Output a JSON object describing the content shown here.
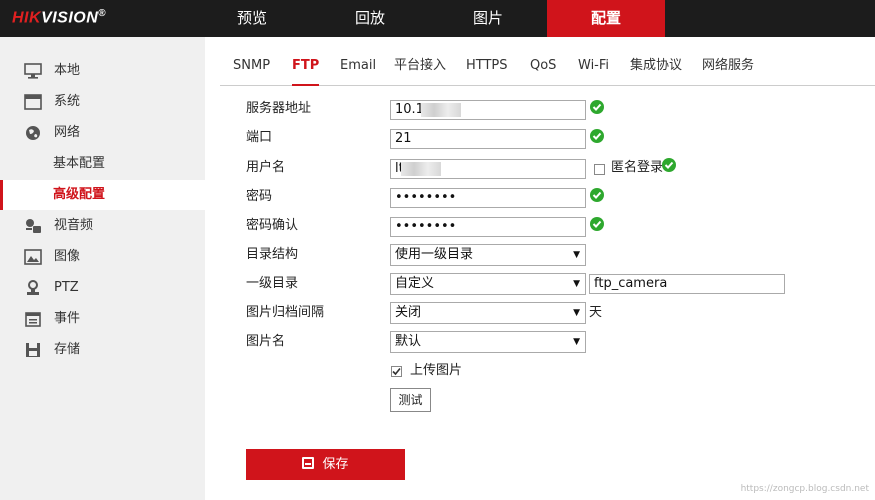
{
  "brand": {
    "hik": "HIK",
    "vision": "VISION",
    "reg": "®"
  },
  "topnav": [
    {
      "label": "预览",
      "active": false
    },
    {
      "label": "回放",
      "active": false
    },
    {
      "label": "图片",
      "active": false
    },
    {
      "label": "配置",
      "active": true
    }
  ],
  "sidebar": {
    "items": [
      {
        "label": "本地",
        "icon": "monitor-icon"
      },
      {
        "label": "系统",
        "icon": "window-icon"
      },
      {
        "label": "网络",
        "icon": "globe-icon"
      },
      {
        "label": "基本配置",
        "sub": true
      },
      {
        "label": "高级配置",
        "sub": true,
        "active": true
      },
      {
        "label": "视音频",
        "icon": "mic-camera-icon"
      },
      {
        "label": "图像",
        "icon": "image-icon"
      },
      {
        "label": "PTZ",
        "icon": "ptz-icon"
      },
      {
        "label": "事件",
        "icon": "calendar-icon"
      },
      {
        "label": "存储",
        "icon": "floppy-icon"
      }
    ]
  },
  "tabs": [
    "SNMP",
    "FTP",
    "Email",
    "平台接入",
    "HTTPS",
    "QoS",
    "Wi-Fi",
    "集成协议",
    "网络服务"
  ],
  "active_tab": "FTP",
  "form": {
    "server_label": "服务器地址",
    "server_value": "10.1.",
    "port_label": "端口",
    "port_value": "21",
    "user_label": "用户名",
    "user_value": "lt",
    "anon_label": "匿名登录",
    "password_label": "密码",
    "password_value": "••••••••",
    "confirm_label": "密码确认",
    "confirm_value": "••••••••",
    "dir_structure_label": "目录结构",
    "dir_structure_value": "使用一级目录",
    "level1_label": "一级目录",
    "level1_value": "自定义",
    "level1_custom": "ftp_camera",
    "archive_label": "图片归档间隔",
    "archive_value": "关闭",
    "archive_unit": "天",
    "picname_label": "图片名",
    "picname_value": "默认",
    "upload_label": "上传图片",
    "test_label": "测试",
    "save_label": "保存"
  },
  "watermark": "https://zongcp.blog.csdn.net",
  "colors": {
    "accent": "#d0141b",
    "ok": "#2ea82e"
  }
}
